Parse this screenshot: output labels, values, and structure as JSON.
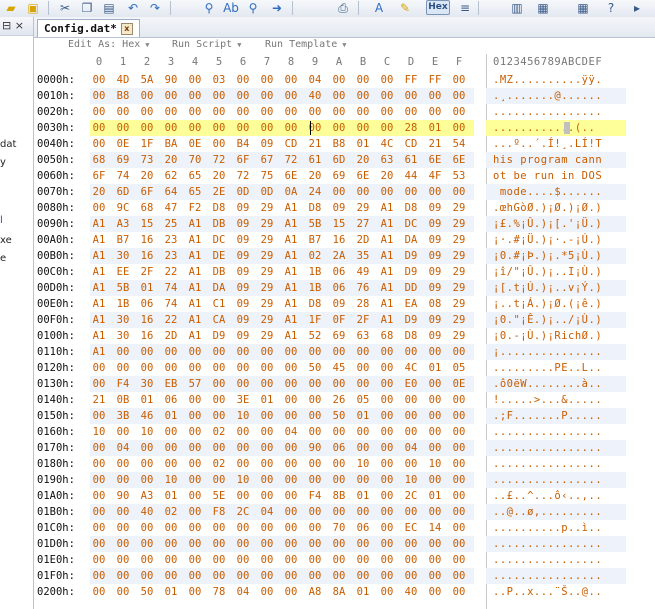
{
  "toolbar": {
    "icons": [
      "open-folder",
      "save-all",
      "cut",
      "copy",
      "paste",
      "undo",
      "redo",
      "find",
      "replace",
      "find-in-files",
      "goto",
      "print",
      "font",
      "highlight",
      "hex",
      "ascii",
      "view-1",
      "view-2",
      "calculator",
      "help"
    ],
    "hex_label": "Hex"
  },
  "left_panel": {
    "fragments": [
      "dat",
      "y",
      "l",
      "xe",
      "e"
    ]
  },
  "tab": {
    "title": "Config.dat*",
    "close_glyph": "x"
  },
  "options": {
    "edit_as": "Edit As: Hex",
    "run_script": "Run Script",
    "run_template": "Run Template"
  },
  "ruler": {
    "columns": [
      "0",
      "1",
      "2",
      "3",
      "4",
      "5",
      "6",
      "7",
      "8",
      "9",
      "A",
      "B",
      "C",
      "D",
      "E",
      "F"
    ],
    "ascii": "0123456789ABCDEF"
  },
  "rows": [
    {
      "addr": "0000h:",
      "bytes": [
        "00",
        "4D",
        "5A",
        "90",
        "00",
        "03",
        "00",
        "00",
        "00",
        "04",
        "00",
        "00",
        "00",
        "FF",
        "FF",
        "00"
      ],
      "ascii": ".MZ..........ÿÿ."
    },
    {
      "addr": "0010h:",
      "bytes": [
        "00",
        "B8",
        "00",
        "00",
        "00",
        "00",
        "00",
        "00",
        "00",
        "40",
        "00",
        "00",
        "00",
        "00",
        "00",
        "00"
      ],
      "ascii": ".¸.......@......"
    },
    {
      "addr": "0020h:",
      "bytes": [
        "00",
        "00",
        "00",
        "00",
        "00",
        "00",
        "00",
        "00",
        "00",
        "00",
        "00",
        "00",
        "00",
        "00",
        "00",
        "00"
      ],
      "ascii": "................"
    },
    {
      "addr": "0030h:",
      "bytes": [
        "00",
        "00",
        "00",
        "00",
        "00",
        "00",
        "00",
        "00",
        "00",
        "00",
        "00",
        "00",
        "00",
        "28",
        "01",
        "00"
      ],
      "ascii": "............(.."
    },
    {
      "addr": "0040h:",
      "bytes": [
        "00",
        "0E",
        "1F",
        "BA",
        "0E",
        "00",
        "B4",
        "09",
        "CD",
        "21",
        "B8",
        "01",
        "4C",
        "CD",
        "21",
        "54"
      ],
      "ascii": "...º..´.Í!¸.LÍ!T"
    },
    {
      "addr": "0050h:",
      "bytes": [
        "68",
        "69",
        "73",
        "20",
        "70",
        "72",
        "6F",
        "67",
        "72",
        "61",
        "6D",
        "20",
        "63",
        "61",
        "6E",
        "6E"
      ],
      "ascii": "his program cann"
    },
    {
      "addr": "0060h:",
      "bytes": [
        "6F",
        "74",
        "20",
        "62",
        "65",
        "20",
        "72",
        "75",
        "6E",
        "20",
        "69",
        "6E",
        "20",
        "44",
        "4F",
        "53"
      ],
      "ascii": "ot be run in DOS"
    },
    {
      "addr": "0070h:",
      "bytes": [
        "20",
        "6D",
        "6F",
        "64",
        "65",
        "2E",
        "0D",
        "0D",
        "0A",
        "24",
        "00",
        "00",
        "00",
        "00",
        "00",
        "00"
      ],
      "ascii": " mode....$......"
    },
    {
      "addr": "0080h:",
      "bytes": [
        "00",
        "9C",
        "68",
        "47",
        "F2",
        "D8",
        "09",
        "29",
        "A1",
        "D8",
        "09",
        "29",
        "A1",
        "D8",
        "09",
        "29"
      ],
      "ascii": ".œhGòØ.)¡Ø.)¡Ø.)"
    },
    {
      "addr": "0090h:",
      "bytes": [
        "A1",
        "A3",
        "15",
        "25",
        "A1",
        "DB",
        "09",
        "29",
        "A1",
        "5B",
        "15",
        "27",
        "A1",
        "DC",
        "09",
        "29"
      ],
      "ascii": "¡£.%¡Û.)¡[.'¡Ü.)"
    },
    {
      "addr": "00A0h:",
      "bytes": [
        "A1",
        "B7",
        "16",
        "23",
        "A1",
        "DC",
        "09",
        "29",
        "A1",
        "B7",
        "16",
        "2D",
        "A1",
        "DA",
        "09",
        "29"
      ],
      "ascii": "¡·.#¡Ü.)¡·.-¡Ú.)"
    },
    {
      "addr": "00B0h:",
      "bytes": [
        "A1",
        "30",
        "16",
        "23",
        "A1",
        "DE",
        "09",
        "29",
        "A1",
        "02",
        "2A",
        "35",
        "A1",
        "D9",
        "09",
        "29"
      ],
      "ascii": "¡0.#¡Þ.)¡.*5¡Ù.)"
    },
    {
      "addr": "00C0h:",
      "bytes": [
        "A1",
        "EE",
        "2F",
        "22",
        "A1",
        "DB",
        "09",
        "29",
        "A1",
        "1B",
        "06",
        "49",
        "A1",
        "D9",
        "09",
        "29"
      ],
      "ascii": "¡î/\"¡Û.)¡..I¡Ù.)"
    },
    {
      "addr": "00D0h:",
      "bytes": [
        "A1",
        "5B",
        "01",
        "74",
        "A1",
        "DA",
        "09",
        "29",
        "A1",
        "1B",
        "06",
        "76",
        "A1",
        "DD",
        "09",
        "29"
      ],
      "ascii": "¡[.t¡Ú.)¡..v¡Ý.)"
    },
    {
      "addr": "00E0h:",
      "bytes": [
        "A1",
        "1B",
        "06",
        "74",
        "A1",
        "C1",
        "09",
        "29",
        "A1",
        "D8",
        "09",
        "28",
        "A1",
        "EA",
        "08",
        "29"
      ],
      "ascii": "¡..t¡Á.)¡Ø.(¡ê.)"
    },
    {
      "addr": "00F0h:",
      "bytes": [
        "A1",
        "30",
        "16",
        "22",
        "A1",
        "CA",
        "09",
        "29",
        "A1",
        "1F",
        "0F",
        "2F",
        "A1",
        "D9",
        "09",
        "29"
      ],
      "ascii": "¡0.\"¡Ê.)¡../¡Ù.)"
    },
    {
      "addr": "0100h:",
      "bytes": [
        "A1",
        "30",
        "16",
        "2D",
        "A1",
        "D9",
        "09",
        "29",
        "A1",
        "52",
        "69",
        "63",
        "68",
        "D8",
        "09",
        "29"
      ],
      "ascii": "¡0.-¡Ù.)¡RichØ.)"
    },
    {
      "addr": "0110h:",
      "bytes": [
        "A1",
        "00",
        "00",
        "00",
        "00",
        "00",
        "00",
        "00",
        "00",
        "00",
        "00",
        "00",
        "00",
        "00",
        "00",
        "00"
      ],
      "ascii": "¡..............."
    },
    {
      "addr": "0120h:",
      "bytes": [
        "00",
        "00",
        "00",
        "00",
        "00",
        "00",
        "00",
        "00",
        "00",
        "50",
        "45",
        "00",
        "00",
        "4C",
        "01",
        "05"
      ],
      "ascii": ".........PE..L.."
    },
    {
      "addr": "0130h:",
      "bytes": [
        "00",
        "F4",
        "30",
        "EB",
        "57",
        "00",
        "00",
        "00",
        "00",
        "00",
        "00",
        "00",
        "00",
        "E0",
        "00",
        "0E"
      ],
      "ascii": ".ô0ëW........à.."
    },
    {
      "addr": "0140h:",
      "bytes": [
        "21",
        "0B",
        "01",
        "06",
        "00",
        "00",
        "3E",
        "01",
        "00",
        "00",
        "26",
        "05",
        "00",
        "00",
        "00",
        "00"
      ],
      "ascii": "!.....>...&....."
    },
    {
      "addr": "0150h:",
      "bytes": [
        "00",
        "3B",
        "46",
        "01",
        "00",
        "00",
        "10",
        "00",
        "00",
        "00",
        "50",
        "01",
        "00",
        "00",
        "00",
        "00"
      ],
      "ascii": ".;F.......P....."
    },
    {
      "addr": "0160h:",
      "bytes": [
        "10",
        "00",
        "10",
        "00",
        "00",
        "02",
        "00",
        "00",
        "04",
        "00",
        "00",
        "00",
        "00",
        "00",
        "00",
        "00"
      ],
      "ascii": "................"
    },
    {
      "addr": "0170h:",
      "bytes": [
        "00",
        "04",
        "00",
        "00",
        "00",
        "00",
        "00",
        "00",
        "00",
        "90",
        "06",
        "00",
        "00",
        "04",
        "00",
        "00"
      ],
      "ascii": "................"
    },
    {
      "addr": "0180h:",
      "bytes": [
        "00",
        "00",
        "00",
        "00",
        "00",
        "02",
        "00",
        "00",
        "00",
        "00",
        "00",
        "10",
        "00",
        "00",
        "10",
        "00"
      ],
      "ascii": "................"
    },
    {
      "addr": "0190h:",
      "bytes": [
        "00",
        "00",
        "00",
        "10",
        "00",
        "00",
        "10",
        "00",
        "00",
        "00",
        "00",
        "00",
        "00",
        "10",
        "00",
        "00"
      ],
      "ascii": "................"
    },
    {
      "addr": "01A0h:",
      "bytes": [
        "00",
        "90",
        "A3",
        "01",
        "00",
        "5E",
        "00",
        "00",
        "00",
        "F4",
        "8B",
        "01",
        "00",
        "2C",
        "01",
        "00"
      ],
      "ascii": "..£..^...ô‹..,.."
    },
    {
      "addr": "01B0h:",
      "bytes": [
        "00",
        "00",
        "40",
        "02",
        "00",
        "F8",
        "2C",
        "04",
        "00",
        "00",
        "00",
        "00",
        "00",
        "00",
        "00",
        "00"
      ],
      "ascii": "..@..ø,........."
    },
    {
      "addr": "01C0h:",
      "bytes": [
        "00",
        "00",
        "00",
        "00",
        "00",
        "00",
        "00",
        "00",
        "00",
        "00",
        "70",
        "06",
        "00",
        "EC",
        "14",
        "00"
      ],
      "ascii": "..........p..ì.."
    },
    {
      "addr": "01D0h:",
      "bytes": [
        "00",
        "00",
        "00",
        "00",
        "00",
        "00",
        "00",
        "00",
        "00",
        "00",
        "00",
        "00",
        "00",
        "00",
        "00",
        "00"
      ],
      "ascii": "................"
    },
    {
      "addr": "01E0h:",
      "bytes": [
        "00",
        "00",
        "00",
        "00",
        "00",
        "00",
        "00",
        "00",
        "00",
        "00",
        "00",
        "00",
        "00",
        "00",
        "00",
        "00"
      ],
      "ascii": "................"
    },
    {
      "addr": "01F0h:",
      "bytes": [
        "00",
        "00",
        "00",
        "00",
        "00",
        "00",
        "00",
        "00",
        "00",
        "00",
        "00",
        "00",
        "00",
        "00",
        "00",
        "00"
      ],
      "ascii": "................"
    },
    {
      "addr": "0200h:",
      "bytes": [
        "00",
        "00",
        "50",
        "01",
        "00",
        "78",
        "04",
        "00",
        "00",
        "A8",
        "8A",
        "01",
        "00",
        "40",
        "00",
        "00"
      ],
      "ascii": "..P..x...¨Š..@.."
    }
  ],
  "highlighted_row": 3,
  "colors": {
    "byte_text": "#c85d00",
    "row_stripe": "#eef2fa",
    "highlight": "#ffff99"
  }
}
